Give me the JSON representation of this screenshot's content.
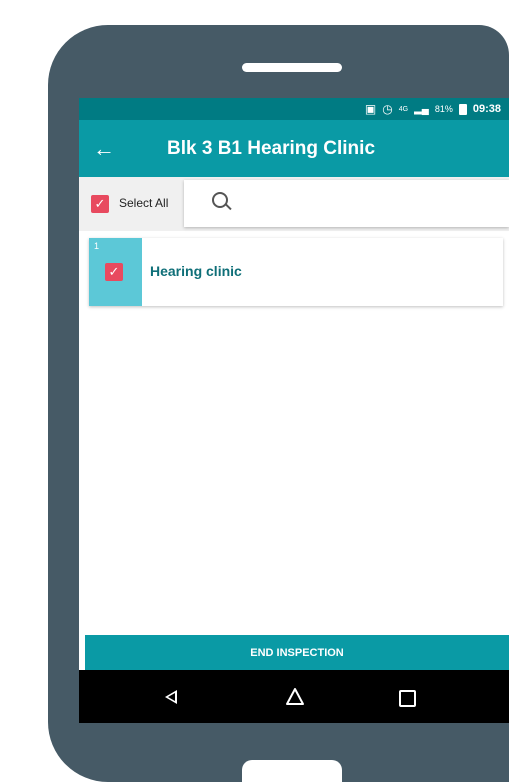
{
  "status_bar": {
    "nfc_icon": "nfc-icon",
    "alarm_icon": "alarm-icon",
    "network": "4G",
    "battery": "81%",
    "time": "09:38"
  },
  "toolbar": {
    "back_icon": "arrow-left-icon",
    "title": "Blk 3 B1 Hearing Clinic"
  },
  "filter": {
    "select_all_label": "Select All",
    "select_all_checked": true,
    "search_placeholder": ""
  },
  "items": [
    {
      "number": "1",
      "label": "Hearing clinic",
      "checked": true
    }
  ],
  "footer": {
    "end_button_label": "END INSPECTION"
  },
  "colors": {
    "primary": "#0a9aa5",
    "status_bar": "#007b83",
    "checkbox": "#e84a5f",
    "item_accent": "#5cc8d7",
    "phone_body": "#465a66"
  }
}
